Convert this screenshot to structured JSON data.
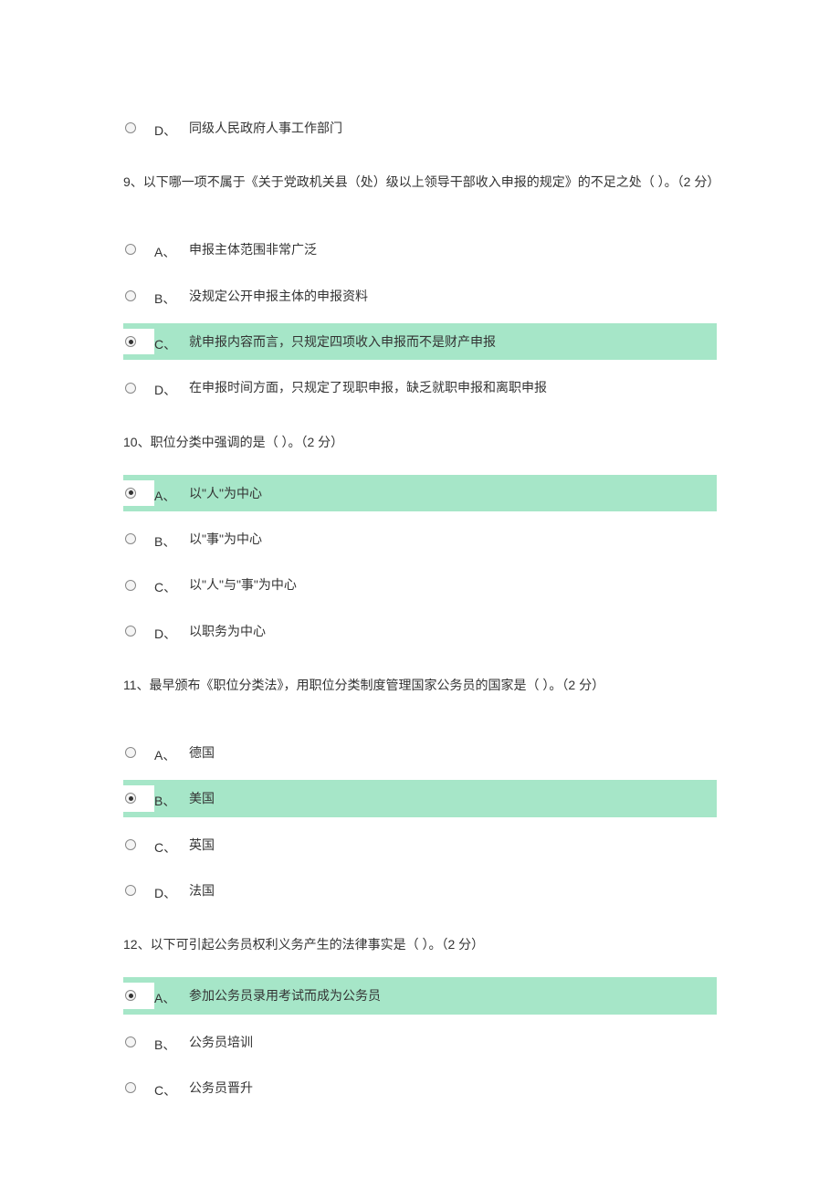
{
  "orphan_option": {
    "letter": "D、",
    "text": "同级人民政府人事工作部门",
    "selected": false
  },
  "questions": [
    {
      "number": "9",
      "prompt": "9、以下哪一项不属于《关于党政机关县（处）级以上领导干部收入申报的规定》的不足之处（ ）。（2 分）",
      "options": [
        {
          "letter": "A、",
          "text": "申报主体范围非常广泛",
          "selected": false
        },
        {
          "letter": "B、",
          "text": "没规定公开申报主体的申报资料",
          "selected": false
        },
        {
          "letter": "C、",
          "text": "就申报内容而言，只规定四项收入申报而不是财产申报",
          "selected": true
        },
        {
          "letter": "D、",
          "text": "在申报时间方面，只规定了现职申报，缺乏就职申报和离职申报",
          "selected": false
        }
      ]
    },
    {
      "number": "10",
      "prompt": "10、职位分类中强调的是（ ）。（2 分）",
      "options": [
        {
          "letter": "A、",
          "text": "以\"人\"为中心",
          "selected": true
        },
        {
          "letter": "B、",
          "text": "以\"事\"为中心",
          "selected": false
        },
        {
          "letter": "C、",
          "text": "以\"人\"与\"事\"为中心",
          "selected": false
        },
        {
          "letter": "D、",
          "text": "以职务为中心",
          "selected": false
        }
      ]
    },
    {
      "number": "11",
      "prompt": "11、最早颁布《职位分类法》，用职位分类制度管理国家公务员的国家是（ ）。（2 分）",
      "options": [
        {
          "letter": "A、",
          "text": "德国",
          "selected": false
        },
        {
          "letter": "B、",
          "text": "美国",
          "selected": true
        },
        {
          "letter": "C、",
          "text": "英国",
          "selected": false
        },
        {
          "letter": "D、",
          "text": "法国",
          "selected": false
        }
      ]
    },
    {
      "number": "12",
      "prompt": "12、以下可引起公务员权利义务产生的法律事实是（ ）。（2 分）",
      "options": [
        {
          "letter": "A、",
          "text": "参加公务员录用考试而成为公务员",
          "selected": true
        },
        {
          "letter": "B、",
          "text": "公务员培训",
          "selected": false
        },
        {
          "letter": "C、",
          "text": "公务员晋升",
          "selected": false
        }
      ]
    }
  ]
}
